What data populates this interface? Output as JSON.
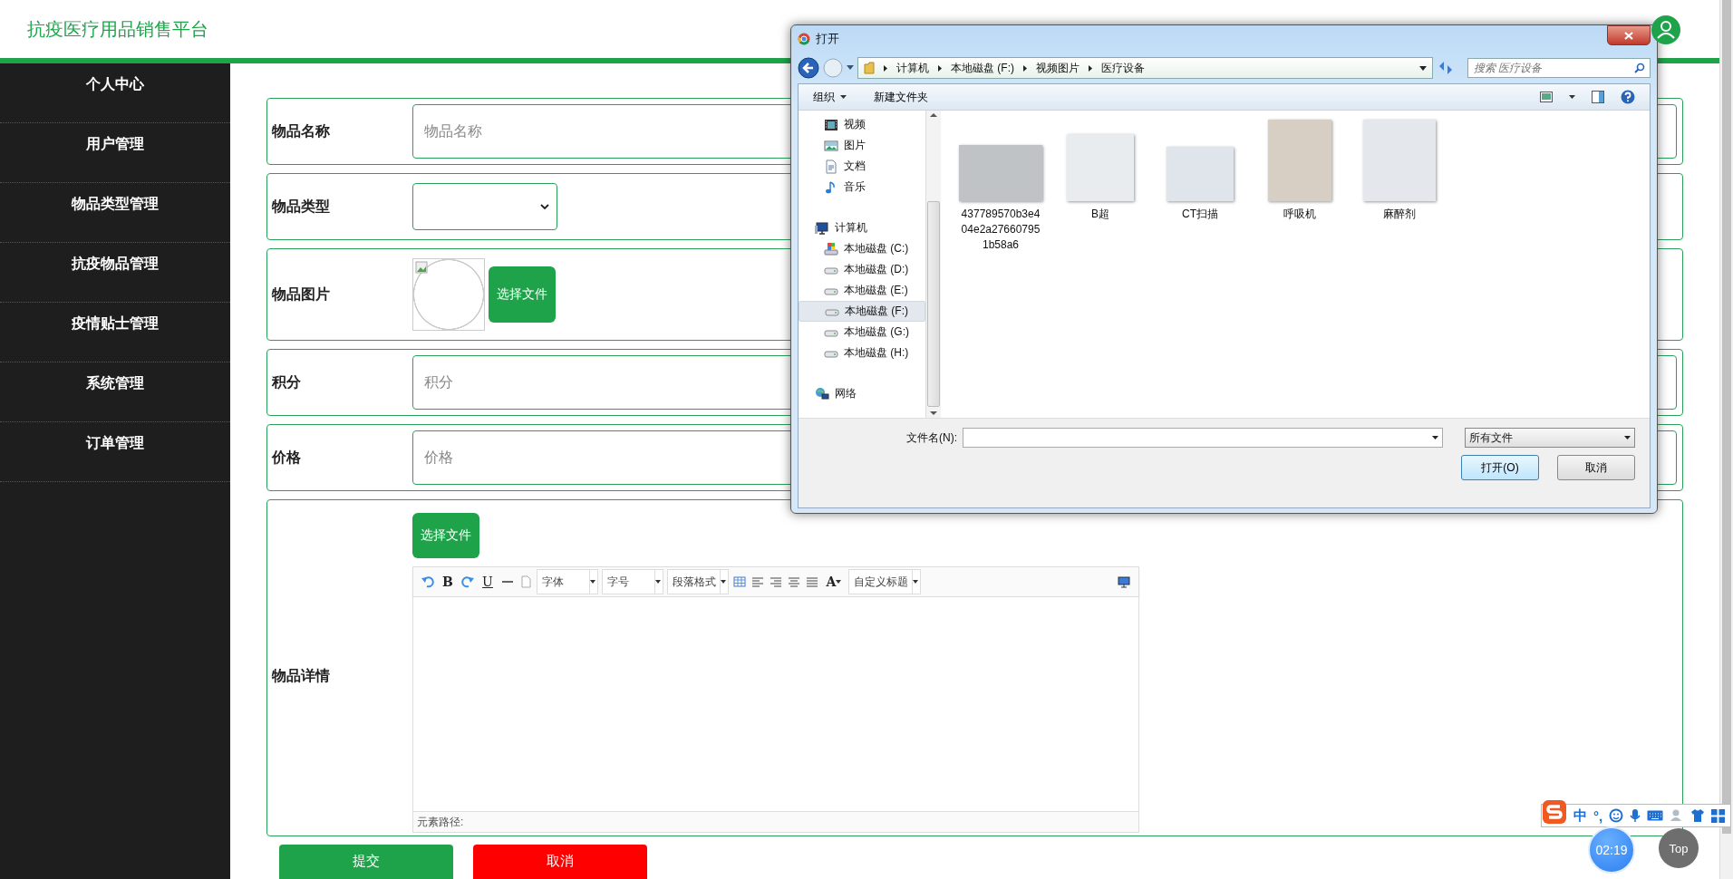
{
  "header": {
    "title": "抗疫医疗用品销售平台"
  },
  "sidebar": {
    "items": [
      {
        "label": "个人中心"
      },
      {
        "label": "用户管理"
      },
      {
        "label": "物品类型管理"
      },
      {
        "label": "抗疫物品管理"
      },
      {
        "label": "疫情贴士管理"
      },
      {
        "label": "系统管理"
      },
      {
        "label": "订单管理"
      }
    ]
  },
  "form": {
    "fields": [
      {
        "kind": "text",
        "label": "物品名称",
        "placeholder": "物品名称"
      },
      {
        "kind": "select",
        "label": "物品类型"
      },
      {
        "kind": "image",
        "label": "物品图片",
        "button": "选择文件"
      },
      {
        "kind": "text",
        "label": "积分",
        "placeholder": "积分"
      },
      {
        "kind": "text",
        "label": "价格",
        "placeholder": "价格"
      },
      {
        "kind": "editor",
        "label": "物品详情",
        "button": "选择文件"
      }
    ],
    "editor": {
      "tools": [
        {
          "kind": "undo"
        },
        {
          "kind": "bold",
          "label": "B"
        },
        {
          "kind": "redo"
        },
        {
          "kind": "underline",
          "label": "U"
        },
        {
          "kind": "hr"
        },
        {
          "kind": "page"
        },
        {
          "kind": "select",
          "label": "字体"
        },
        {
          "kind": "select",
          "label": "字号"
        },
        {
          "kind": "select",
          "label": "段落格式"
        },
        {
          "kind": "table"
        },
        {
          "kind": "align-left"
        },
        {
          "kind": "align-right"
        },
        {
          "kind": "align-center"
        },
        {
          "kind": "justify"
        },
        {
          "kind": "fontcolor",
          "label": "A"
        },
        {
          "kind": "select",
          "label": "自定义标题"
        },
        {
          "kind": "preview"
        }
      ],
      "path_label": "元素路径:"
    },
    "buttons": [
      {
        "kind": "submit",
        "label": "提交"
      },
      {
        "kind": "cancel",
        "label": "取消"
      }
    ]
  },
  "dialog": {
    "title": "打开",
    "breadcrumb": [
      "计算机",
      "本地磁盘 (F:)",
      "视频图片",
      "医疗设备"
    ],
    "search": {
      "placeholder": "搜索 医疗设备"
    },
    "toolbar": [
      "组织",
      "新建文件夹"
    ],
    "nav": [
      {
        "kind": "video",
        "label": "视频",
        "selected": false
      },
      {
        "kind": "picture",
        "label": "图片",
        "selected": false
      },
      {
        "kind": "document",
        "label": "文档",
        "selected": false
      },
      {
        "kind": "music",
        "label": "音乐",
        "selected": false
      },
      {
        "kind": "computer",
        "label": "计算机",
        "selected": false,
        "children": [
          {
            "kind": "system-drive",
            "label": "本地磁盘 (C:)",
            "selected": false
          },
          {
            "kind": "drive",
            "label": "本地磁盘 (D:)",
            "selected": false
          },
          {
            "kind": "drive",
            "label": "本地磁盘 (E:)",
            "selected": false
          },
          {
            "kind": "drive",
            "label": "本地磁盘 (F:)",
            "selected": true
          },
          {
            "kind": "drive",
            "label": "本地磁盘 (G:)",
            "selected": false
          },
          {
            "kind": "drive",
            "label": "本地磁盘 (H:)",
            "selected": false
          }
        ]
      },
      {
        "kind": "network",
        "label": "网络",
        "selected": false
      }
    ],
    "files": [
      {
        "name": "437789570b3e404e2a276607951b58a6"
      },
      {
        "name": "B超"
      },
      {
        "name": "CT扫描"
      },
      {
        "name": "呼吸机"
      },
      {
        "name": "麻醉剂"
      }
    ],
    "filename": {
      "label": "文件名(N):"
    },
    "filter": "所有文件",
    "buttons": [
      {
        "kind": "open",
        "label": "打开(O)"
      },
      {
        "kind": "cancel",
        "label": "取消"
      }
    ]
  },
  "ime": {
    "mode": "中",
    "punct": "°,"
  },
  "timer": "02:19",
  "top_button": "Top"
}
